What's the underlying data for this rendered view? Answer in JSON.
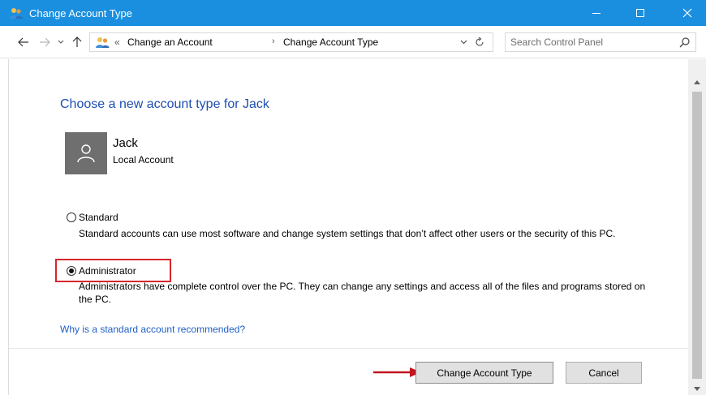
{
  "window": {
    "title": "Change Account Type",
    "min_glyph": "—",
    "max_glyph": "☐",
    "close_glyph": "✕",
    "accent_color": "#1a8fe0"
  },
  "nav": {
    "back_icon": "back-arrow-icon",
    "forward_icon": "forward-arrow-icon",
    "up_icon": "up-arrow-icon",
    "breadcrumb_sep_glyph": "«",
    "crumb_arrow_glyph": "›",
    "breadcrumbs": [
      "Change an Account",
      "Change Account Type"
    ],
    "search_placeholder": "Search Control Panel"
  },
  "main": {
    "heading": "Choose a new account type for Jack",
    "user": {
      "name": "Jack",
      "type": "Local Account"
    },
    "options": [
      {
        "label": "Standard",
        "description": "Standard accounts can use most software and change system settings that don’t affect other users or the security of this PC.",
        "selected": false
      },
      {
        "label": "Administrator",
        "description": "Administrators have complete control over the PC. They can change any settings and access all of the files and programs stored on the PC.",
        "selected": true
      }
    ],
    "help_link": "Why is a standard account recommended?"
  },
  "footer": {
    "primary_button": "Change Account Type",
    "cancel_button": "Cancel"
  },
  "colors": {
    "heading": "#1e4fb0",
    "link": "#1e5fc8",
    "highlight": "#d8262d",
    "arrow": "#c0151f"
  }
}
